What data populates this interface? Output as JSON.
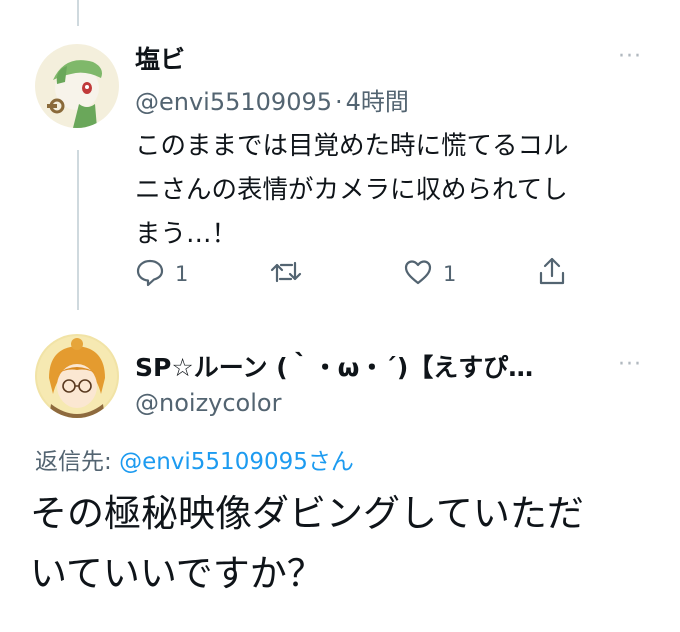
{
  "tweet1": {
    "display_name": "塩ビ",
    "handle": "@envi55109095",
    "separator": "·",
    "time": "4時間",
    "more": "···",
    "text_lines": [
      "このままでは目覚めた時に慌てるコル",
      "ニさんの表情がカメラに収められてし",
      "まう…！"
    ],
    "reply_count": "1",
    "like_count": "1",
    "icons": [
      "reply-icon",
      "retweet-icon",
      "like-icon",
      "share-icon"
    ]
  },
  "tweet2": {
    "display_name": "SP☆ルーン (｀・ω・´)【えすぴ…",
    "handle": "@noizycolor",
    "more": "···",
    "reply_label": "返信先:",
    "reply_handle": "@envi55109095",
    "reply_suffix": "さん",
    "text_lines": [
      "その極秘映像ダビングしていただ",
      "いていいですか？"
    ]
  },
  "colors": {
    "link": "#1d9bf0",
    "secondary": "#536471",
    "thread_line": "#cfd9de"
  }
}
